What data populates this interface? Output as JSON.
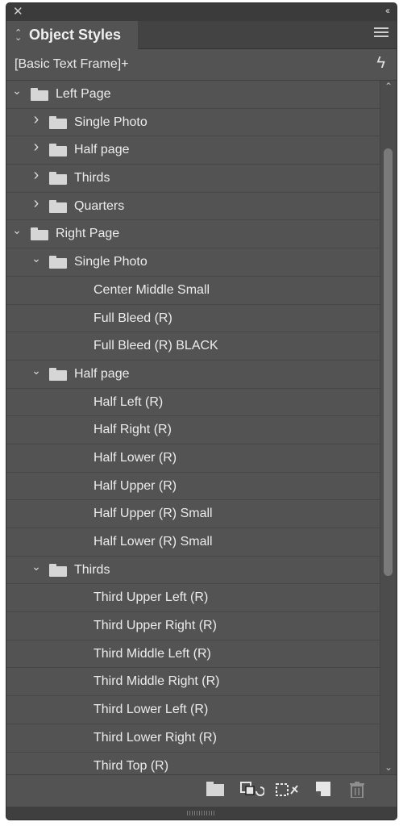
{
  "titlebar": {
    "close_icon": "✕",
    "collapse_icon": "‹‹"
  },
  "tab": {
    "label": "Object Styles"
  },
  "current_style": "[Basic Text Frame]+",
  "tree": [
    {
      "label": "Left Page",
      "level": 0,
      "type": "folder",
      "expanded": true
    },
    {
      "label": "Single Photo",
      "level": 1,
      "type": "folder",
      "expanded": false
    },
    {
      "label": "Half page",
      "level": 1,
      "type": "folder",
      "expanded": false
    },
    {
      "label": "Thirds",
      "level": 1,
      "type": "folder",
      "expanded": false
    },
    {
      "label": "Quarters",
      "level": 1,
      "type": "folder",
      "expanded": false
    },
    {
      "label": "Right Page",
      "level": 0,
      "type": "folder",
      "expanded": true
    },
    {
      "label": "Single Photo",
      "level": 1,
      "type": "folder",
      "expanded": true
    },
    {
      "label": "Center Middle Small",
      "level": 2,
      "type": "style"
    },
    {
      "label": "Full Bleed (R)",
      "level": 2,
      "type": "style"
    },
    {
      "label": "Full Bleed (R) BLACK",
      "level": 2,
      "type": "style"
    },
    {
      "label": "Half page",
      "level": 1,
      "type": "folder",
      "expanded": true
    },
    {
      "label": "Half Left (R)",
      "level": 2,
      "type": "style"
    },
    {
      "label": "Half Right (R)",
      "level": 2,
      "type": "style"
    },
    {
      "label": "Half Lower (R)",
      "level": 2,
      "type": "style"
    },
    {
      "label": "Half Upper (R)",
      "level": 2,
      "type": "style"
    },
    {
      "label": "Half Upper (R) Small",
      "level": 2,
      "type": "style"
    },
    {
      "label": "Half Lower (R) Small",
      "level": 2,
      "type": "style"
    },
    {
      "label": "Thirds",
      "level": 1,
      "type": "folder",
      "expanded": true
    },
    {
      "label": "Third Upper Left (R)",
      "level": 2,
      "type": "style"
    },
    {
      "label": "Third Upper Right (R)",
      "level": 2,
      "type": "style"
    },
    {
      "label": "Third Middle Left (R)",
      "level": 2,
      "type": "style"
    },
    {
      "label": "Third Middle Right (R)",
      "level": 2,
      "type": "style"
    },
    {
      "label": "Third Lower Left (R)",
      "level": 2,
      "type": "style"
    },
    {
      "label": "Third Lower Right (R)",
      "level": 2,
      "type": "style"
    },
    {
      "label": "Third Top (R)",
      "level": 2,
      "type": "style"
    }
  ],
  "bottom_icons": [
    "new-group-icon",
    "clear-overrides-icon",
    "clear-non-defined-attributes-icon",
    "new-style-icon",
    "delete-icon"
  ],
  "colors": {
    "panel": "#535353",
    "titlebar": "#3b3b3b",
    "text": "#ececec",
    "folder": "#d6d6d6"
  }
}
